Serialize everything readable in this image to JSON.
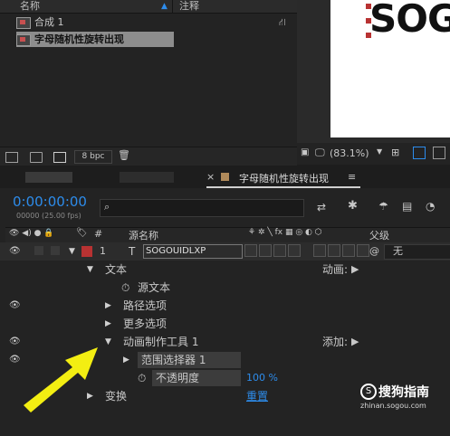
{
  "project": {
    "col_name": "名称",
    "col_comment": "注释",
    "items": [
      {
        "label": "合成 1"
      },
      {
        "label": "字母随机性旋转出现"
      }
    ],
    "bpc": "8 bpc"
  },
  "viewer": {
    "canvas_text": "SOG",
    "zoom": "(83.1%)"
  },
  "timeline": {
    "comp_tab": "字母随机性旋转出现",
    "timecode": "0:00:00:00",
    "frames": "00000 (25.00 fps)",
    "search_placeholder": "",
    "col_hash": "#",
    "col_source": "源名称",
    "col_parent": "父级",
    "layer_index": "1",
    "layer_type": "T",
    "layer_name": "SOGOUIDLXP",
    "parent_value": "无",
    "rows": {
      "text": "文本",
      "animate_label": "动画:",
      "source_text": "源文本",
      "path_options": "路径选项",
      "more_options": "更多选项",
      "animator": "动画制作工具 1",
      "add_label": "添加:",
      "range_selector": "范围选择器 1",
      "opacity": "不透明度",
      "opacity_value": "100 %",
      "transform": "变换",
      "reset": "重置"
    }
  },
  "watermark": {
    "brand": "搜狗指南",
    "url": "zhinan.sogou.com"
  },
  "colors": {
    "accent": "#2d8ceb",
    "arrow": "#f3ee12",
    "layer_label": "#b83232"
  }
}
